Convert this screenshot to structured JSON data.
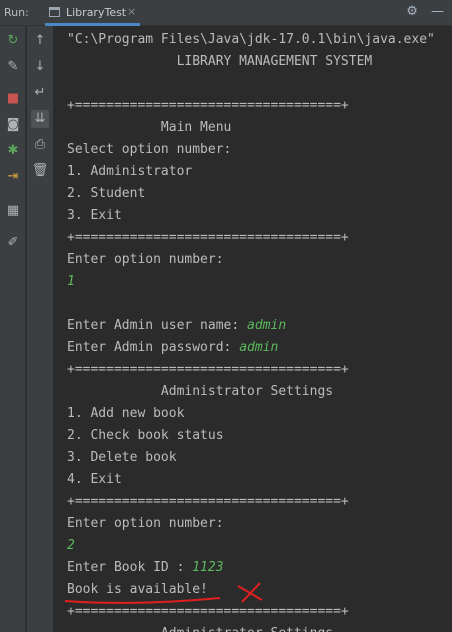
{
  "toolbar": {
    "run_label": "Run:",
    "tab_label": "LibraryTest",
    "tab_close": "×",
    "icons": [
      "settings-icon",
      "minimize-icon"
    ]
  },
  "left_tools": [
    "rerun-icon",
    "wrench-icon",
    "stop-icon",
    "camera-icon",
    "debug-icon",
    "exit-icon",
    "layout-icon",
    "pin-icon"
  ],
  "second_tools": [
    "up-arrow-icon",
    "down-arrow-icon",
    "soft-wrap-icon",
    "scroll-end-icon",
    "print-icon",
    "trash-icon"
  ],
  "console": {
    "lines": [
      {
        "text": "\"C:\\Program Files\\Java\\jdk-17.0.1\\bin\\java.exe\""
      },
      {
        "text": "              LIBRARY MANAGEMENT SYSTEM"
      },
      {
        "text": ""
      },
      {
        "text": "+==================================+"
      },
      {
        "text": "            Main Menu"
      },
      {
        "text": "Select option number:"
      },
      {
        "text": "1. Administrator"
      },
      {
        "text": "2. Student"
      },
      {
        "text": "3. Exit"
      },
      {
        "text": "+==================================+"
      },
      {
        "text": "Enter option number:"
      },
      {
        "text": "",
        "input": "1"
      },
      {
        "text": ""
      },
      {
        "text": "Enter Admin user name: ",
        "input": "admin"
      },
      {
        "text": "Enter Admin password: ",
        "input": "admin"
      },
      {
        "text": "+==================================+"
      },
      {
        "text": "            Administrator Settings"
      },
      {
        "text": "1. Add new book"
      },
      {
        "text": "2. Check book status"
      },
      {
        "text": "3. Delete book"
      },
      {
        "text": "4. Exit"
      },
      {
        "text": "+==================================+"
      },
      {
        "text": "Enter option number:"
      },
      {
        "text": "",
        "input": "2"
      },
      {
        "text": "Enter Book ID : ",
        "input": "1123"
      },
      {
        "text": "Book is available!"
      },
      {
        "text": "+==================================+"
      },
      {
        "text": "            Administrator Settings"
      }
    ]
  }
}
